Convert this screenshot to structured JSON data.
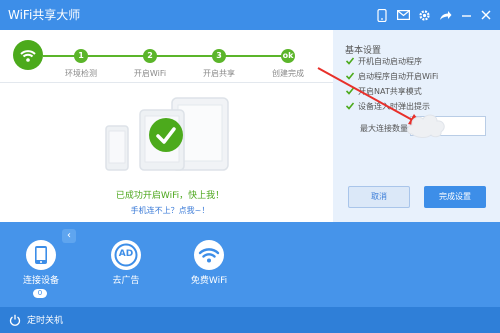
{
  "app": {
    "title": "WiFi共享大师"
  },
  "titlebar_icons": [
    "phone-icon",
    "mail-icon",
    "gear-icon",
    "share-icon",
    "minimize-icon",
    "close-icon"
  ],
  "steps": [
    {
      "badge": "1",
      "label": "环境检测"
    },
    {
      "badge": "2",
      "label": "开启WiFi"
    },
    {
      "badge": "3",
      "label": "开启共享"
    },
    {
      "badge": "ok",
      "label": "创建完成"
    }
  ],
  "main": {
    "success_message": "已成功开启WiFi，快上我！",
    "hint_link": "手机连不上？点我~！"
  },
  "settings": {
    "title": "基本设置",
    "options": [
      {
        "label": "开机自动启动程序",
        "checked": true
      },
      {
        "label": "启动程序自动开启WiFi",
        "checked": true
      },
      {
        "label": "开启NAT共享模式",
        "checked": true
      },
      {
        "label": "设备连入时弹出提示",
        "checked": true
      }
    ],
    "max_conn_label": "最大连接数量",
    "max_conn_value": "",
    "cancel_label": "取消",
    "finish_label": "完成设置"
  },
  "tools": [
    {
      "label": "连接设备",
      "badge": "0",
      "icon": "phone-icon"
    },
    {
      "label": "去广告",
      "icon": "ad-block-icon",
      "icon_text": "AD"
    },
    {
      "label": "免费WiFi",
      "icon": "wifi-icon"
    }
  ],
  "footer": {
    "timer_label": "定时关机"
  },
  "colors": {
    "titlebar": "#3d8ee8",
    "accent_green": "#4caa1c",
    "panel_blue": "#4694ea",
    "footer": "#2f7fd8"
  }
}
